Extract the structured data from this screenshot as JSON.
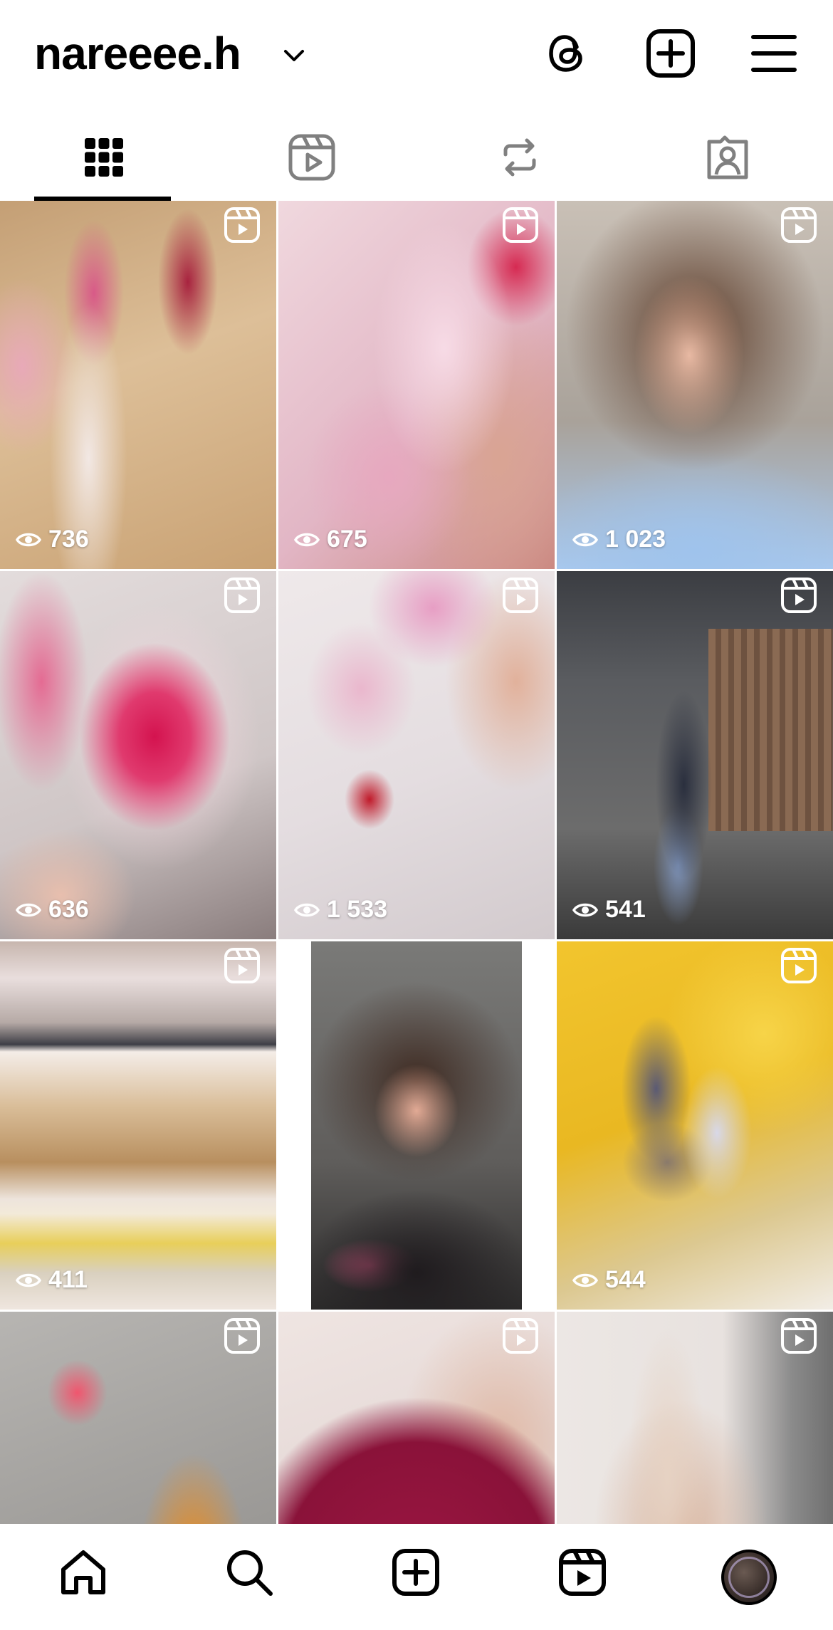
{
  "header": {
    "username": "nareeee.h",
    "icons": [
      "threads-icon",
      "new-post-icon",
      "menu-icon"
    ]
  },
  "tabs": [
    {
      "name": "posts-grid",
      "icon": "grid-icon",
      "active": true
    },
    {
      "name": "reels",
      "icon": "reels-icon",
      "active": false
    },
    {
      "name": "reposts",
      "icon": "repost-icon",
      "active": false
    },
    {
      "name": "tagged",
      "icon": "tagged-icon",
      "active": false
    }
  ],
  "grid": [
    {
      "views": "736",
      "reel": true
    },
    {
      "views": "675",
      "reel": true
    },
    {
      "views": "1 023",
      "reel": true
    },
    {
      "views": "636",
      "reel": true
    },
    {
      "views": "1 533",
      "reel": true
    },
    {
      "views": "541",
      "reel": true
    },
    {
      "views": "411",
      "reel": true
    },
    {
      "views": "",
      "reel": false
    },
    {
      "views": "544",
      "reel": true
    },
    {
      "views": "",
      "reel": true
    },
    {
      "views": "",
      "reel": true
    },
    {
      "views": "",
      "reel": true
    }
  ],
  "bottom_nav": [
    "home-icon",
    "search-icon",
    "create-icon",
    "reels-icon",
    "profile-avatar"
  ],
  "colors": {
    "text": "#000000",
    "background": "#ffffff",
    "overlay_text": "#ffffff"
  }
}
